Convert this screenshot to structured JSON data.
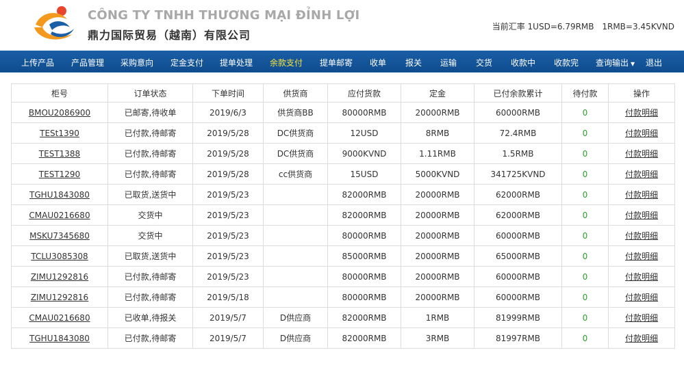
{
  "header": {
    "company_vn": "CÔNG TY TNHH THƯƠNG MẠI ĐỈNH LỢI",
    "company_cn": "鼎力国际贸易（越南）有限公司",
    "rate_label": "当前汇率 1USD=6.79RMB",
    "rate_kvnd": "1RMB=3.45KVND",
    "logo_colors": {
      "orange": "#f39a1e",
      "blue": "#1a5ea6",
      "red": "#e8452c"
    }
  },
  "nav": {
    "items": [
      {
        "label": "上传产品",
        "active": false
      },
      {
        "label": "产品管理",
        "active": false
      },
      {
        "label": "采购意向",
        "active": false
      },
      {
        "label": "定金支付",
        "active": false
      },
      {
        "label": "提单处理",
        "active": false
      },
      {
        "label": "余款支付",
        "active": true
      },
      {
        "label": "提单邮寄",
        "active": false
      },
      {
        "label": "收单",
        "active": false
      },
      {
        "label": "报关",
        "active": false
      },
      {
        "label": "运输",
        "active": false
      },
      {
        "label": "交货",
        "active": false
      },
      {
        "label": "收款中",
        "active": false
      },
      {
        "label": "收款完",
        "active": false
      },
      {
        "label": "查询输出",
        "active": false,
        "dropdown": true
      },
      {
        "label": "退出",
        "active": false
      }
    ],
    "bg_color": "#1a5ea6",
    "active_color": "#f7e33a"
  },
  "table": {
    "columns": [
      "柜号",
      "订单状态",
      "下单时间",
      "供货商",
      "应付货款",
      "定金",
      "已付余款累计",
      "待付款",
      "操作"
    ],
    "rows": [
      [
        "BMOU2086900",
        "已邮寄,待收单",
        "2019/6/3",
        "供货商BB",
        "80000RMB",
        "20000RMB",
        "60000RMB",
        "0",
        "付款明细"
      ],
      [
        "TESt1390",
        "已付款,待邮寄",
        "2019/5/28",
        "DC供货商",
        "12USD",
        "8RMB",
        "72.4RMB",
        "0",
        "付款明细"
      ],
      [
        "TEST1388",
        "已付款,待邮寄",
        "2019/5/28",
        "DC供货商",
        "9000KVND",
        "1.11RMB",
        "1.5RMB",
        "0",
        "付款明细"
      ],
      [
        "TEST1290",
        "已付款,待邮寄",
        "2019/5/28",
        "cc供货商",
        "15USD",
        "5000KVND",
        "341725KVND",
        "0",
        "付款明细"
      ],
      [
        "TGHU1843080",
        "已取货,送货中",
        "2019/5/23",
        "",
        "82000RMB",
        "20000RMB",
        "62000RMB",
        "0",
        "付款明细"
      ],
      [
        "CMAU0216680",
        "交货中",
        "2019/5/23",
        "",
        "82000RMB",
        "20000RMB",
        "62000RMB",
        "0",
        "付款明细"
      ],
      [
        "MSKU7345680",
        "交货中",
        "2019/5/23",
        "",
        "80000RMB",
        "20000RMB",
        "60000RMB",
        "0",
        "付款明细"
      ],
      [
        "TCLU3085308",
        "已取货,送货中",
        "2019/5/23",
        "",
        "85000RMB",
        "20000RMB",
        "65000RMB",
        "0",
        "付款明细"
      ],
      [
        "ZIMU1292816",
        "已付款,待邮寄",
        "2019/5/23",
        "",
        "80000RMB",
        "20000RMB",
        "60000RMB",
        "0",
        "付款明细"
      ],
      [
        "ZIMU1292816",
        "已付款,待邮寄",
        "2019/5/18",
        "",
        "80000RMB",
        "20000RMB",
        "60000RMB",
        "0",
        "付款明细"
      ],
      [
        "CMAU0216680",
        "已收单,待报关",
        "2019/5/7",
        "D供应商",
        "82000RMB",
        "1RMB",
        "81999RMB",
        "0",
        "付款明细"
      ],
      [
        "TGHU1843080",
        "已付款,待邮寄",
        "2019/5/7",
        "D供应商",
        "82000RMB",
        "3RMB",
        "81997RMB",
        "0",
        "付款明细"
      ]
    ],
    "pending_color": "#2ca02c"
  }
}
